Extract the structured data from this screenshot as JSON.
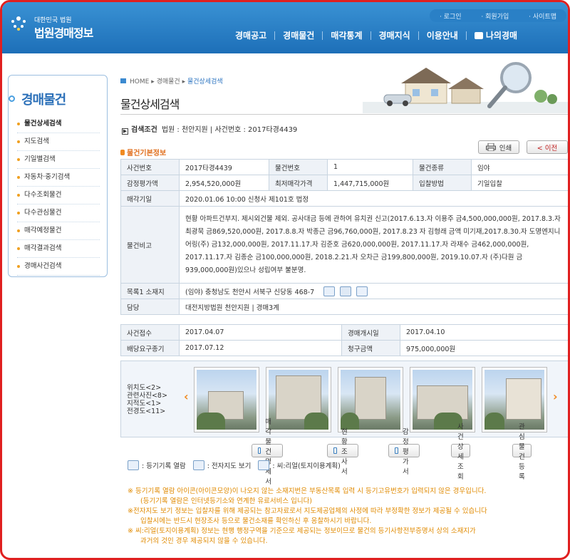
{
  "header": {
    "logo_small": "대한민국 법원",
    "logo_big": "법원경매정보",
    "util": [
      "· 로그인",
      "· 회원가입",
      "· 사이트맵"
    ],
    "gnb": [
      "경매공고",
      "경매물건",
      "매각통계",
      "경매지식",
      "이용안내",
      "나의경매"
    ]
  },
  "lnb": {
    "title": "경매물건",
    "items": [
      "물건상세검색",
      "지도검색",
      "기일별검색",
      "자동차·중기검색",
      "다수조회물건",
      "다수관심물건",
      "매각예정물건",
      "매각결과검색",
      "경매사건검색"
    ]
  },
  "breadcrumb": {
    "home": "HOME",
    "level1": "경매물건",
    "current": "물건상세검색"
  },
  "page_title": "물건상세검색",
  "search_cond": {
    "label": "검색조건",
    "text": "법원 : 천안지원 | 사건번호 : 2017타경4439"
  },
  "section_title": "물건기본정보",
  "buttons": {
    "print": "인쇄",
    "prev": "< 이전"
  },
  "basic": {
    "case_no_label": "사건번호",
    "case_no": "2017타경4439",
    "item_no_label": "물건번호",
    "item_no": "1",
    "item_type_label": "물건종류",
    "item_type": "임야",
    "appraisal_label": "감정평가액",
    "appraisal": "2,954,520,000원",
    "min_price_label": "최저매각가격",
    "min_price": "1,447,715,000원",
    "bid_method_label": "입찰방법",
    "bid_method": "기일입찰",
    "sale_date_label": "매각기일",
    "sale_date": "2020.01.06 10:00 신청사 제101호 법정",
    "note_label": "물건비고",
    "note": "현황 아파트건부지. 제시외건물 제외. 공사대금 등에 관하여 유치권 신고(2017.6.13.자 이용주 금4,500,000,000원, 2017.8.3.자 최광묵 금869,520,000원, 2017.8.8.자 박종근 금96,760,000원, 2017.8.23 자 김형래 금액 미기재,2017.8.30.자 도명엔지니어링(주) 금132,000,000원, 2017.11.17.자 김준호 금620,000,000원, 2017.11.17.자 라재수 금462,000,000원, 2017.11.17.자 김종순 금100,000,000원, 2018.2.21.자 오차근 금199,800,000원, 2019.10.07.자 (주)다원 금939,000,000원)있으나 성립여부 불분명.",
    "location_label": "목록1 소재지",
    "location": "(임야) 충청남도 천안시 서북구 신당동 468-7",
    "charge_label": "담당",
    "charge": "대전지방법원 천안지원 | 경매3계"
  },
  "dates": {
    "received_label": "사건접수",
    "received": "2017.04.07",
    "auction_start_label": "경매개시일",
    "auction_start": "2017.04.10",
    "dividend_label": "배당요구종기",
    "dividend": "2017.07.12",
    "claim_label": "청구금액",
    "claim": "975,000,000원"
  },
  "photo_labels": [
    "위치도<2>",
    "관련사진<8>",
    "지적도<1>",
    "전경도<11>"
  ],
  "actions": [
    "매각물건명세서",
    "현황조사서",
    "감정평가서",
    "사건상세조회",
    "관심물건등록"
  ],
  "legend": [
    ": 등기기록 열람",
    ": 전자지도 보기",
    ": 씨:리얼(토지이용계획)"
  ],
  "notes": [
    "※ 등기기록 열람 아이콘(아이콘모양)이 나오지 않는 소재지번은 부동산목록 입력 시 등기고유번호가 입력되지 않은 경우입니다.",
    "(등기기록 열람은 인터넷등기소와 연계한 유료서비스 입니다)",
    "※전자지도 보기 정보는 입찰자를 위해 제공되는 참고자료로서 지도제공업체의 사정에 따라 부정확한 정보가 제공될 수 있습니다",
    "입찰시에는 반드시 현장조사 등으로 물건소재를 확인하신 후 응찰하시기 바랍니다.",
    "※ 씨:리얼(토지이용계획) 정보는 현행 행정구역을 기준으로 제공되는 정보이므로 물건의 등기사항전부증명서 상의 소재지가",
    "과거의 것인 경우 제공되지 않을 수 있습니다."
  ]
}
